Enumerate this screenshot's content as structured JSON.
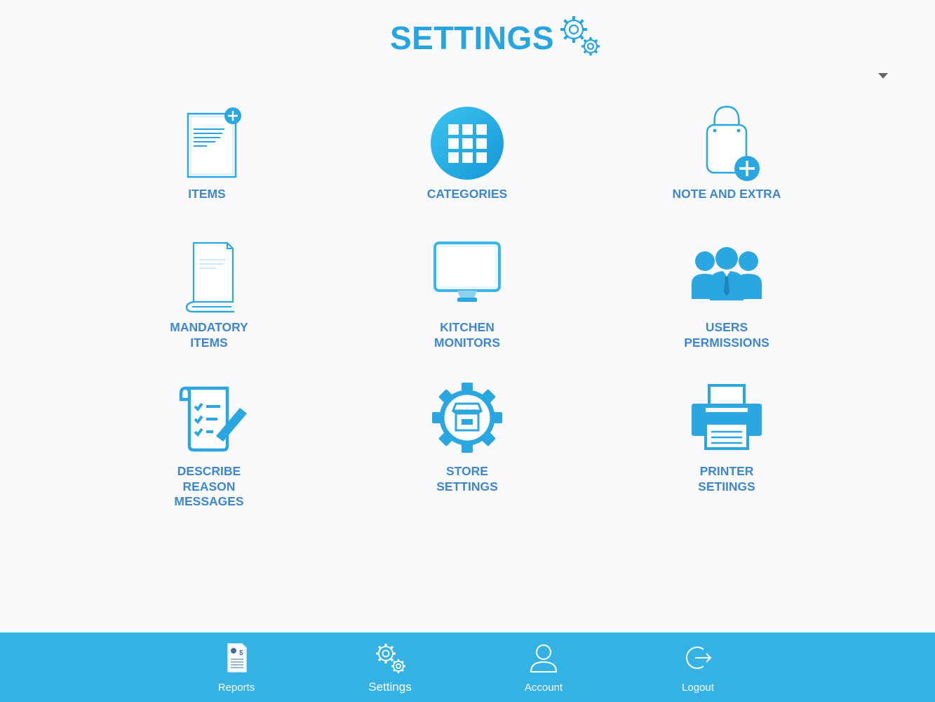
{
  "header": {
    "title": "SETTINGS"
  },
  "colors": {
    "accent": "#27a5e0",
    "label": "#3d86d0",
    "bottom_bar": "#35b2e4"
  },
  "tiles": [
    {
      "label": "ITEMS",
      "icon": "document-add-icon"
    },
    {
      "label": "CATEGORIES",
      "icon": "grid-icon"
    },
    {
      "label": "NOTE AND EXTRA",
      "icon": "bag-add-icon"
    },
    {
      "label": "MANDATORY\nITEMS",
      "icon": "book-icon"
    },
    {
      "label": "KITCHEN\nMONITORS",
      "icon": "monitor-icon"
    },
    {
      "label": "USERS\nPERMISSIONS",
      "icon": "users-icon"
    },
    {
      "label": "DESCRIBE\nREASON\nMESSAGES",
      "icon": "checklist-pencil-icon"
    },
    {
      "label": "STORE\nSETTINGS",
      "icon": "store-gear-icon"
    },
    {
      "label": "PRINTER\nSETIINGS",
      "icon": "printer-icon"
    }
  ],
  "bottom_nav": [
    {
      "label": "Reports",
      "icon": "report-icon"
    },
    {
      "label": "Settings",
      "icon": "gears-icon",
      "active": true
    },
    {
      "label": "Account",
      "icon": "user-icon"
    },
    {
      "label": "Logout",
      "icon": "logout-icon"
    }
  ]
}
